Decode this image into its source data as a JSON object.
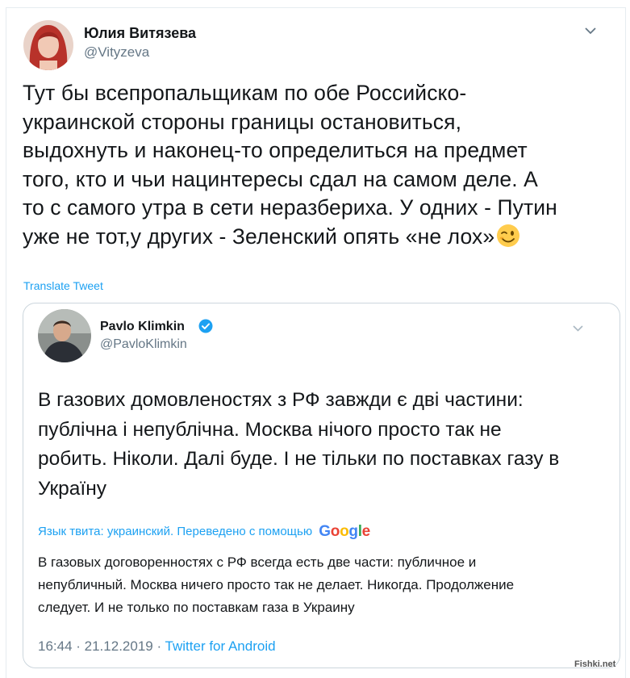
{
  "main_tweet": {
    "author_name": "Юлия Витязева",
    "author_handle": "@Vityzeva",
    "lines": [
      "Тут бы всепропальщикам по обе Российско-",
      "украинской стороны границы остановиться,",
      "выдохнуть и наконец-то определиться на предмет",
      "того, кто и чьи нацинтересы сдал на самом деле. А",
      "то с самого утра в сети неразбериха. У одних - Путин",
      "уже не тот,у других - Зеленский опять «не лох»"
    ],
    "emoji_icon": "winking-face-emoji",
    "translate_label": "Translate Tweet"
  },
  "quoted_tweet": {
    "author_name": "Pavlo Klimkin",
    "author_handle": "@PavloKlimkin",
    "verified_icon": "verified-badge-icon",
    "lines": [
      "В газових домовленостях з РФ завжди є дві частини:",
      "публічна і непублічна. Москва нічого просто так не",
      "робить. Ніколи. Далі буде. І не тільки по поставках газу в",
      "Україну"
    ],
    "translation_note": "Язык твита: украинский. Переведено с помощью",
    "translation_brand": "Google",
    "translated_lines": [
      "В газовых договоренностях с РФ всегда есть две части: публичное и",
      "непубличный. Москва ничего просто так не делает. Никогда. Продолжение",
      "следует. И не только по поставкам газа в Украину"
    ],
    "timestamp": "16:44 · 21.12.2019 · ",
    "source": "Twitter for Android"
  },
  "watermark": "Fishki.net",
  "colors": {
    "link": "#1da1f2",
    "secondary_text": "#657786",
    "border": "#ccd6dd",
    "google": [
      "#4285F4",
      "#EA4335",
      "#FBBC05",
      "#4285F4",
      "#34A853",
      "#EA4335"
    ]
  }
}
